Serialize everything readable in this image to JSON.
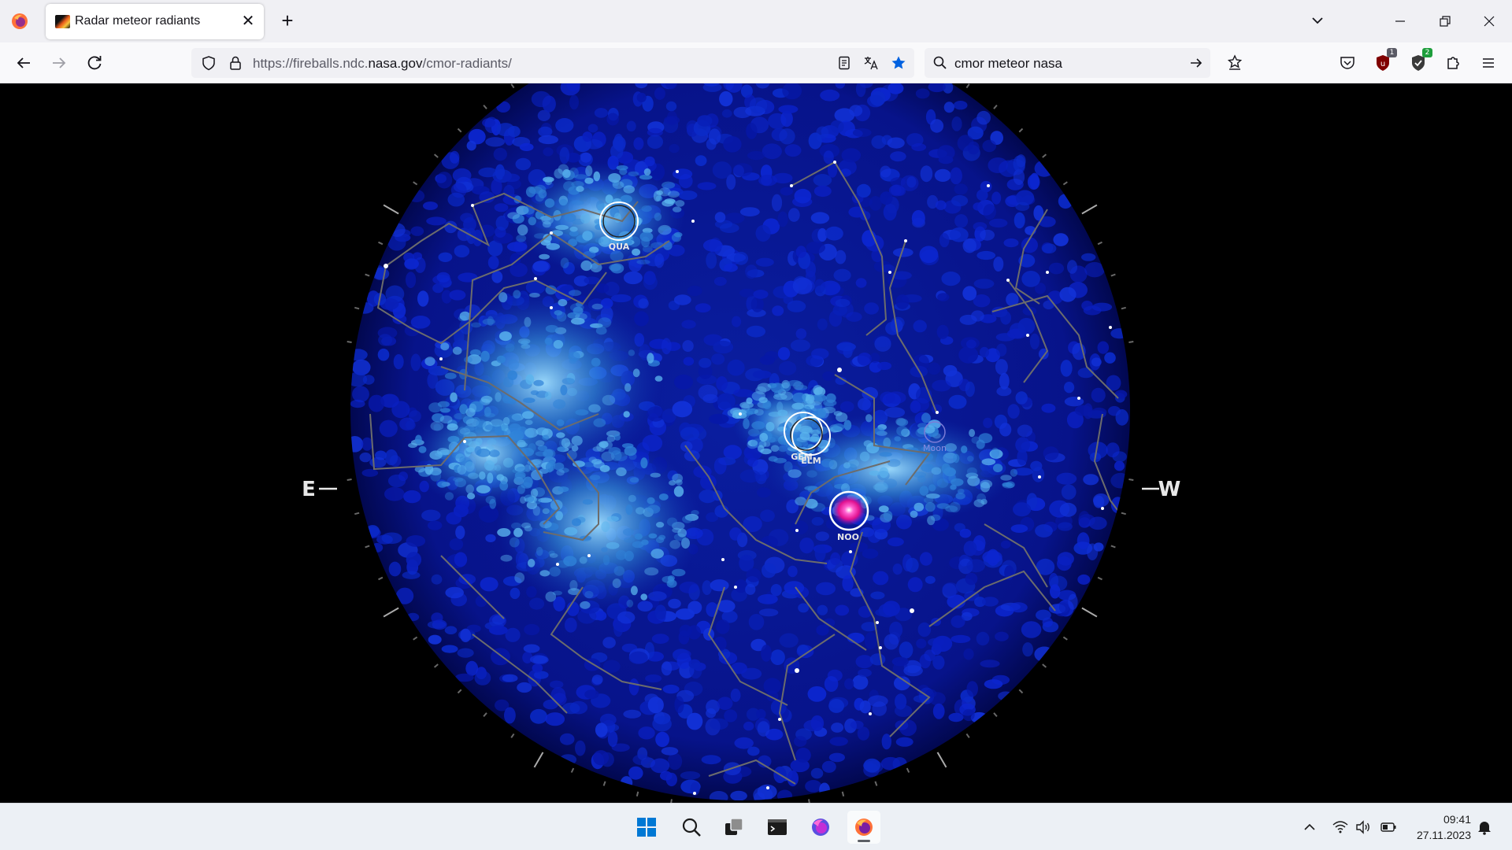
{
  "browser": {
    "tab": {
      "title": "Radar meteor radiants",
      "close_glyph": "✕"
    },
    "new_tab_glyph": "+",
    "url": {
      "prefix": "https://fireballs.ndc.",
      "domain": "nasa.gov",
      "path": "/cmor-radiants/"
    },
    "search_query": "cmor meteor nasa",
    "extensions": {
      "ublock_badge": "1",
      "second_badge": "2"
    },
    "accent_color": "#0061e0"
  },
  "sky_map": {
    "direction_labels": {
      "east": "E",
      "west": "W"
    },
    "showers": [
      {
        "code": "QUA"
      },
      {
        "code": "GEM"
      },
      {
        "code": "ELM"
      },
      {
        "code": "NOO"
      }
    ],
    "moon_label": "Moon",
    "colors": {
      "background": "#000000",
      "density_low": "#0010b0",
      "density_high": "#6ec8f0",
      "hotspot": "#ff1fa8"
    }
  },
  "taskbar": {
    "apps": [
      "start-icon",
      "search-icon",
      "task-view-icon",
      "terminal-icon",
      "firefox-nightly-icon",
      "firefox-icon"
    ],
    "time": "09:41",
    "date": "27.11.2023"
  }
}
